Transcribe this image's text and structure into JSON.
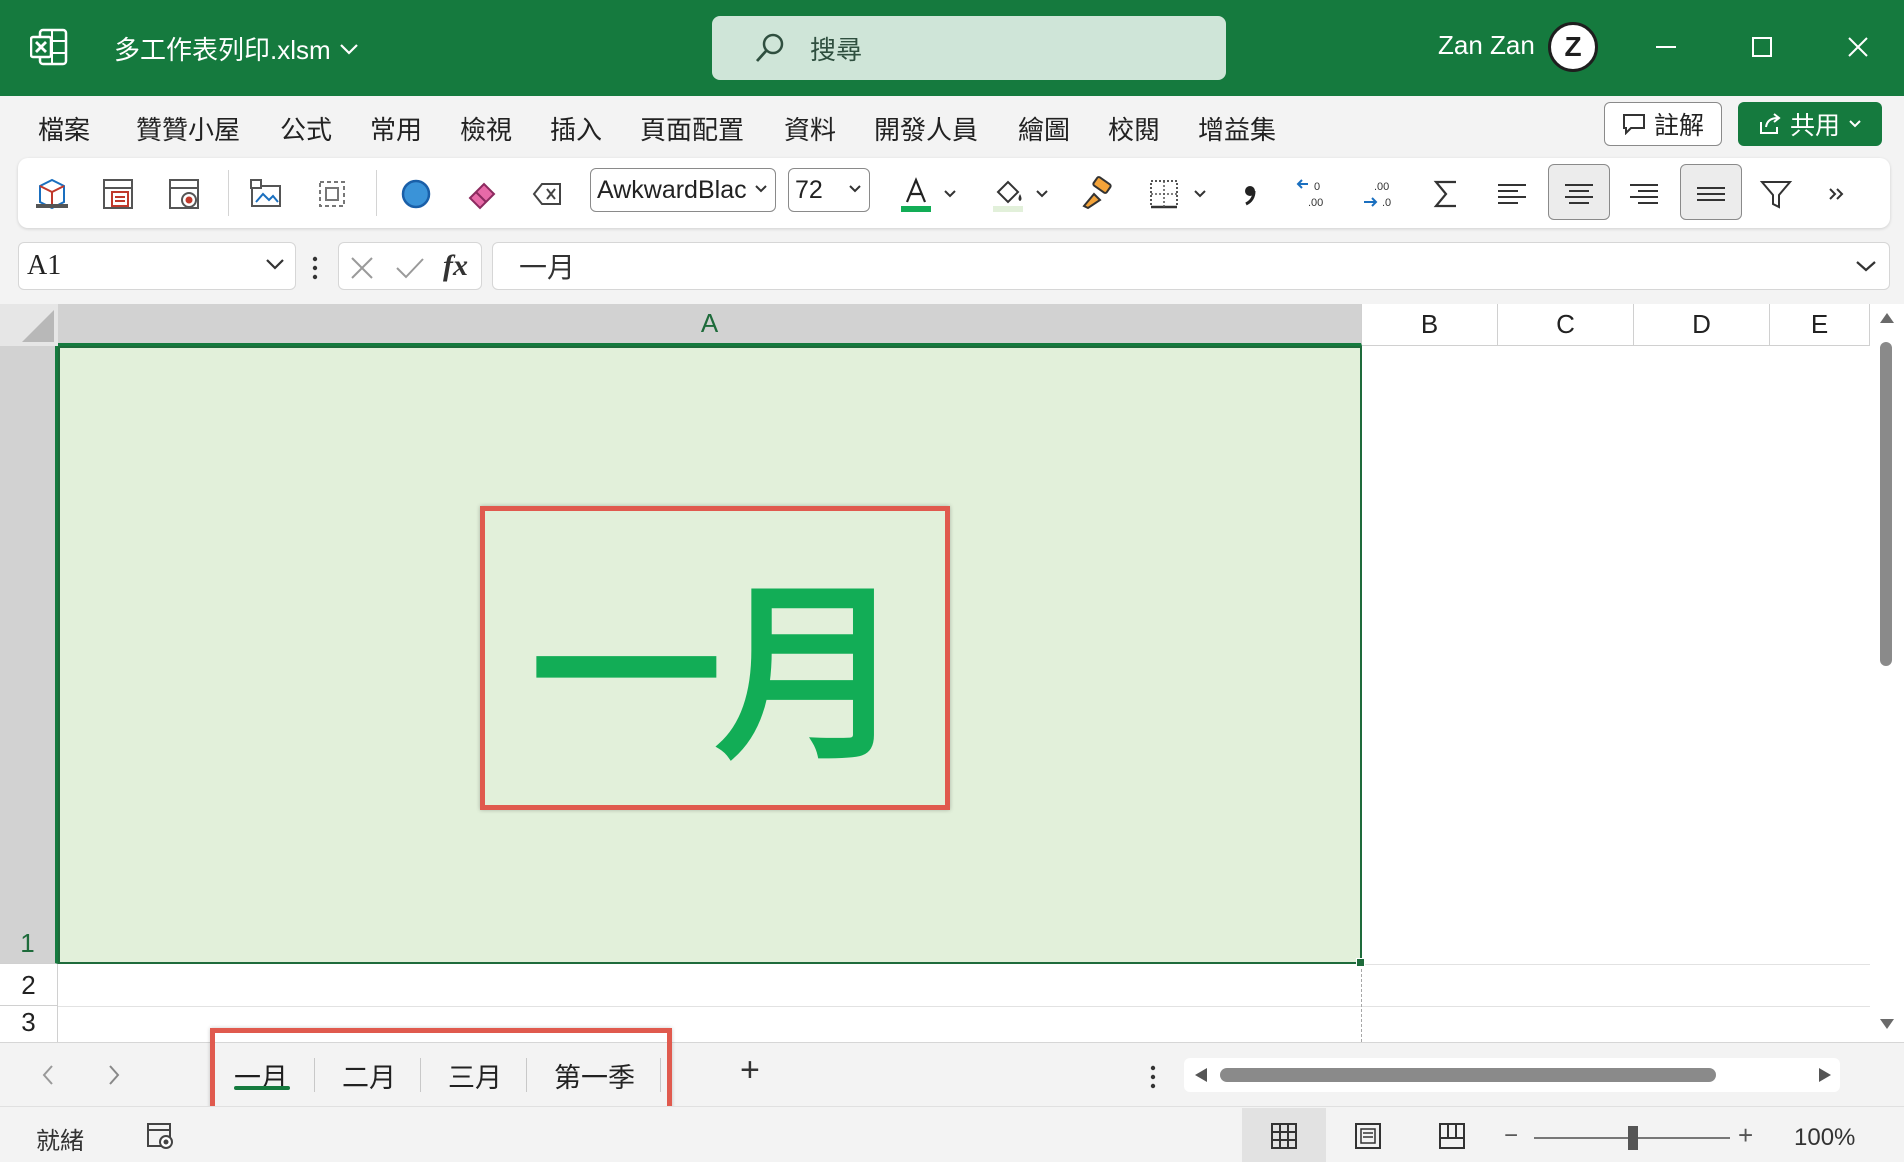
{
  "titlebar": {
    "file_name": "多工作表列印.xlsm",
    "search_placeholder": "搜尋",
    "user_name": "Zan Zan",
    "avatar_letter": "Z",
    "brand_color": "#157a3e"
  },
  "menu": {
    "items": [
      "檔案",
      "贊贊小屋",
      "公式",
      "常用",
      "檢視",
      "插入",
      "頁面配置",
      "資料",
      "開發人員",
      "繪圖",
      "校閱",
      "增益集"
    ],
    "comment_label": "註解",
    "share_label": "共用"
  },
  "ribbon": {
    "font_name": "AwkwardBlac",
    "font_size": "72"
  },
  "formula_bar": {
    "name_box": "A1",
    "fx_symbol": "fx",
    "content": "一月"
  },
  "grid": {
    "columns": [
      "A",
      "B",
      "C",
      "D",
      "E"
    ],
    "rows": [
      "1",
      "2",
      "3"
    ],
    "selected_cell": "A1",
    "cell_a1_text": "一月",
    "cell_fill_color": "#e2f0da",
    "cell_text_color": "#12ad56"
  },
  "sheets": {
    "tabs": [
      "一月",
      "二月",
      "三月",
      "第一季"
    ],
    "active": "一月",
    "add_symbol": "+"
  },
  "status": {
    "ready": "就緒",
    "zoom": "100%",
    "zoom_minus": "−",
    "zoom_plus": "+"
  },
  "highlight_color": "#e05a4e"
}
